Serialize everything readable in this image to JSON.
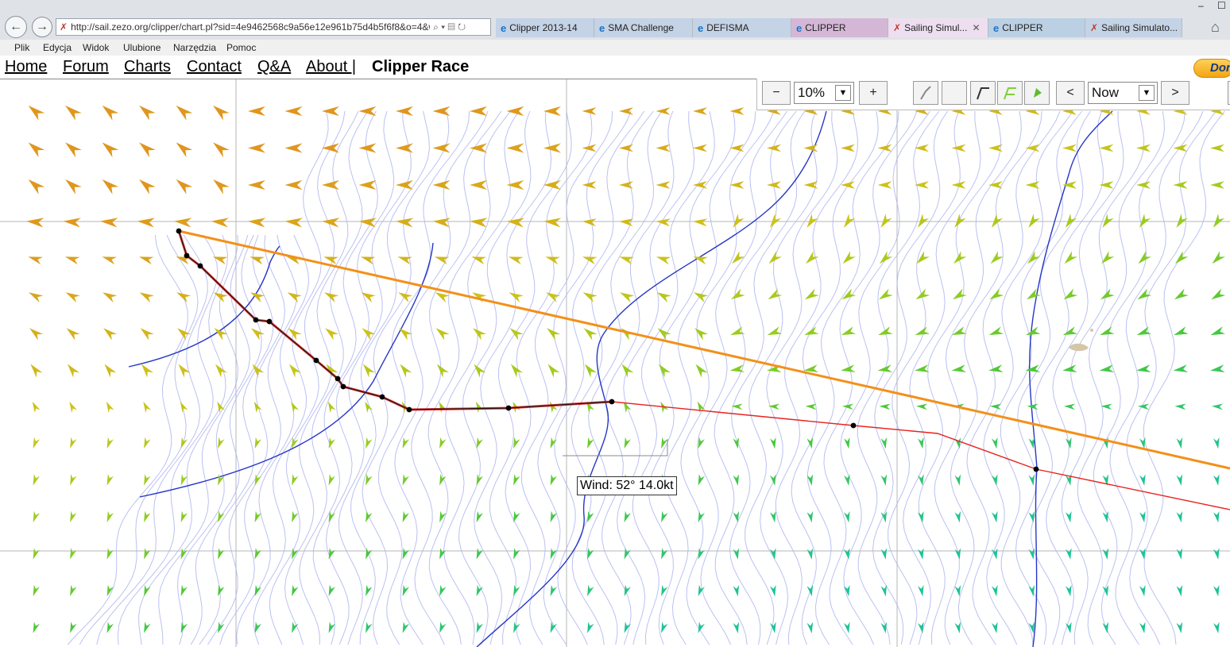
{
  "browser": {
    "address": "http://sail.zezo.org/clipper/chart.pl?sid=4e9462568c9a56e12e961b75d4b5f6f8&o=4&w",
    "tabs": [
      {
        "label": "Clipper 2013-14",
        "icon": "ie-icon"
      },
      {
        "label": "SMA Challenge",
        "icon": "ie-icon"
      },
      {
        "label": "DEFISMA",
        "icon": "ie-icon"
      },
      {
        "label": "CLIPPER",
        "icon": "ie-icon"
      },
      {
        "label": "Sailing Simul...",
        "icon": "sail-icon",
        "active": true
      },
      {
        "label": "CLIPPER",
        "icon": "ie-icon"
      },
      {
        "label": "Sailing Simulato...",
        "icon": "sail-icon"
      }
    ],
    "menu": [
      "Plik",
      "Edycja",
      "Widok",
      "Ulubione",
      "Narzędzia",
      "Pomoc"
    ]
  },
  "site": {
    "nav": [
      "Home",
      "Forum",
      "Charts",
      "Contact",
      "Q&A",
      "About |"
    ],
    "brand": "Clipper Race",
    "donate_label": "Don"
  },
  "toolbar": {
    "zoom_out": "−",
    "zoom_value": "10%",
    "zoom_in": "+",
    "time_prev": "<",
    "time_value": "Now",
    "time_next": ">"
  },
  "map": {
    "tooltip": "Wind: 52° 14.0kt",
    "colors": {
      "great_circle": "#f39019",
      "route": "#e8221f",
      "track": "#1a1a1a",
      "isobar": "#aab2ee",
      "isobar_bold": "#2637c4",
      "grid": "#b7b7b7"
    }
  }
}
